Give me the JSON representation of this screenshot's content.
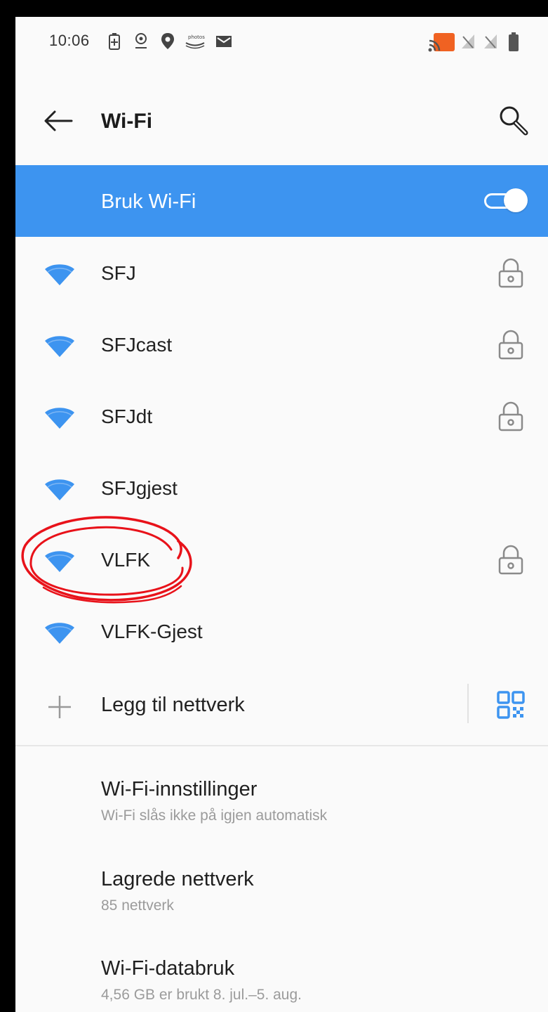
{
  "status_bar": {
    "time": "10:06",
    "icons": [
      "battery-saver-icon",
      "location-pin-icon",
      "map-pin-icon",
      "amazon-photos-icon",
      "mail-icon",
      "cast-icon",
      "no-signal-icon",
      "no-signal-icon",
      "battery-icon"
    ]
  },
  "header": {
    "title": "Wi-Fi",
    "back_icon": "back-arrow-icon",
    "search_icon": "search-icon"
  },
  "wifi_toggle": {
    "label": "Bruk Wi-Fi",
    "state": "on"
  },
  "networks": [
    {
      "name": "SFJ",
      "secured": true
    },
    {
      "name": "SFJcast",
      "secured": true
    },
    {
      "name": "SFJdt",
      "secured": true
    },
    {
      "name": "SFJgjest",
      "secured": false
    },
    {
      "name": "VLFK",
      "secured": true,
      "highlighted": true
    },
    {
      "name": "VLFK-Gjest",
      "secured": false
    }
  ],
  "add_network": {
    "label": "Legg til nettverk",
    "plus_icon": "plus-icon",
    "qr_icon": "qr-code-icon"
  },
  "settings": [
    {
      "title": "Wi-Fi-innstillinger",
      "subtitle": "Wi-Fi slås ikke på igjen automatisk"
    },
    {
      "title": "Lagrede nettverk",
      "subtitle": "85 nettverk"
    },
    {
      "title": "Wi-Fi-databruk",
      "subtitle": "4,56 GB er brukt 8. jul.–5. aug."
    }
  ],
  "colors": {
    "accent": "#3d94f0",
    "wifi_icon": "#3d94f0",
    "annotation": "#e8121a",
    "background": "#fafafa"
  }
}
